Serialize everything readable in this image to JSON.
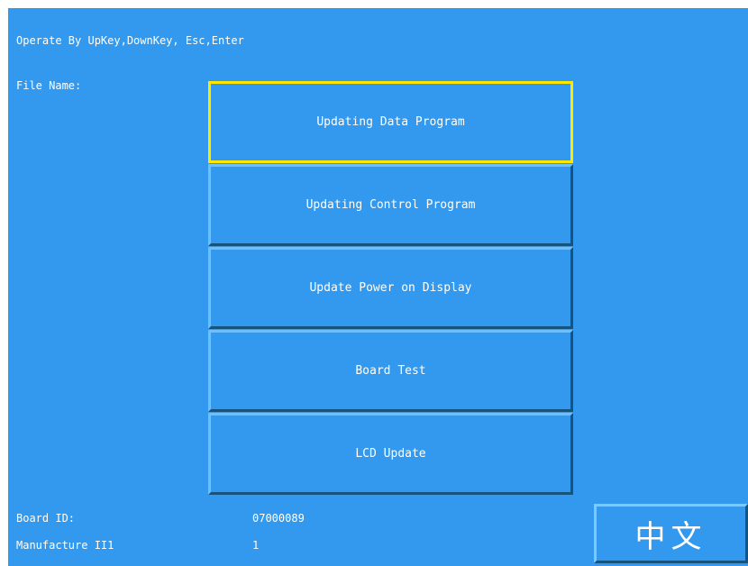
{
  "header": {
    "instructions": "Operate By UpKey,DownKey, Esc,Enter",
    "file_name_label": "File Name:"
  },
  "menu": {
    "selected_index": 0,
    "items": [
      {
        "label": "Updating Data Program"
      },
      {
        "label": "Updating Control Program"
      },
      {
        "label": "Update Power on Display"
      },
      {
        "label": "Board Test"
      },
      {
        "label": "LCD Update"
      }
    ]
  },
  "footer": {
    "board_id_label": "Board ID:",
    "board_id_value": "07000089",
    "manufacture_label": "Manufacture II1",
    "manufacture_value": "1",
    "language_button_label": "中文"
  },
  "colors": {
    "background": "#3399ee",
    "text": "#ffffff",
    "selection_border": "#ffe800"
  }
}
